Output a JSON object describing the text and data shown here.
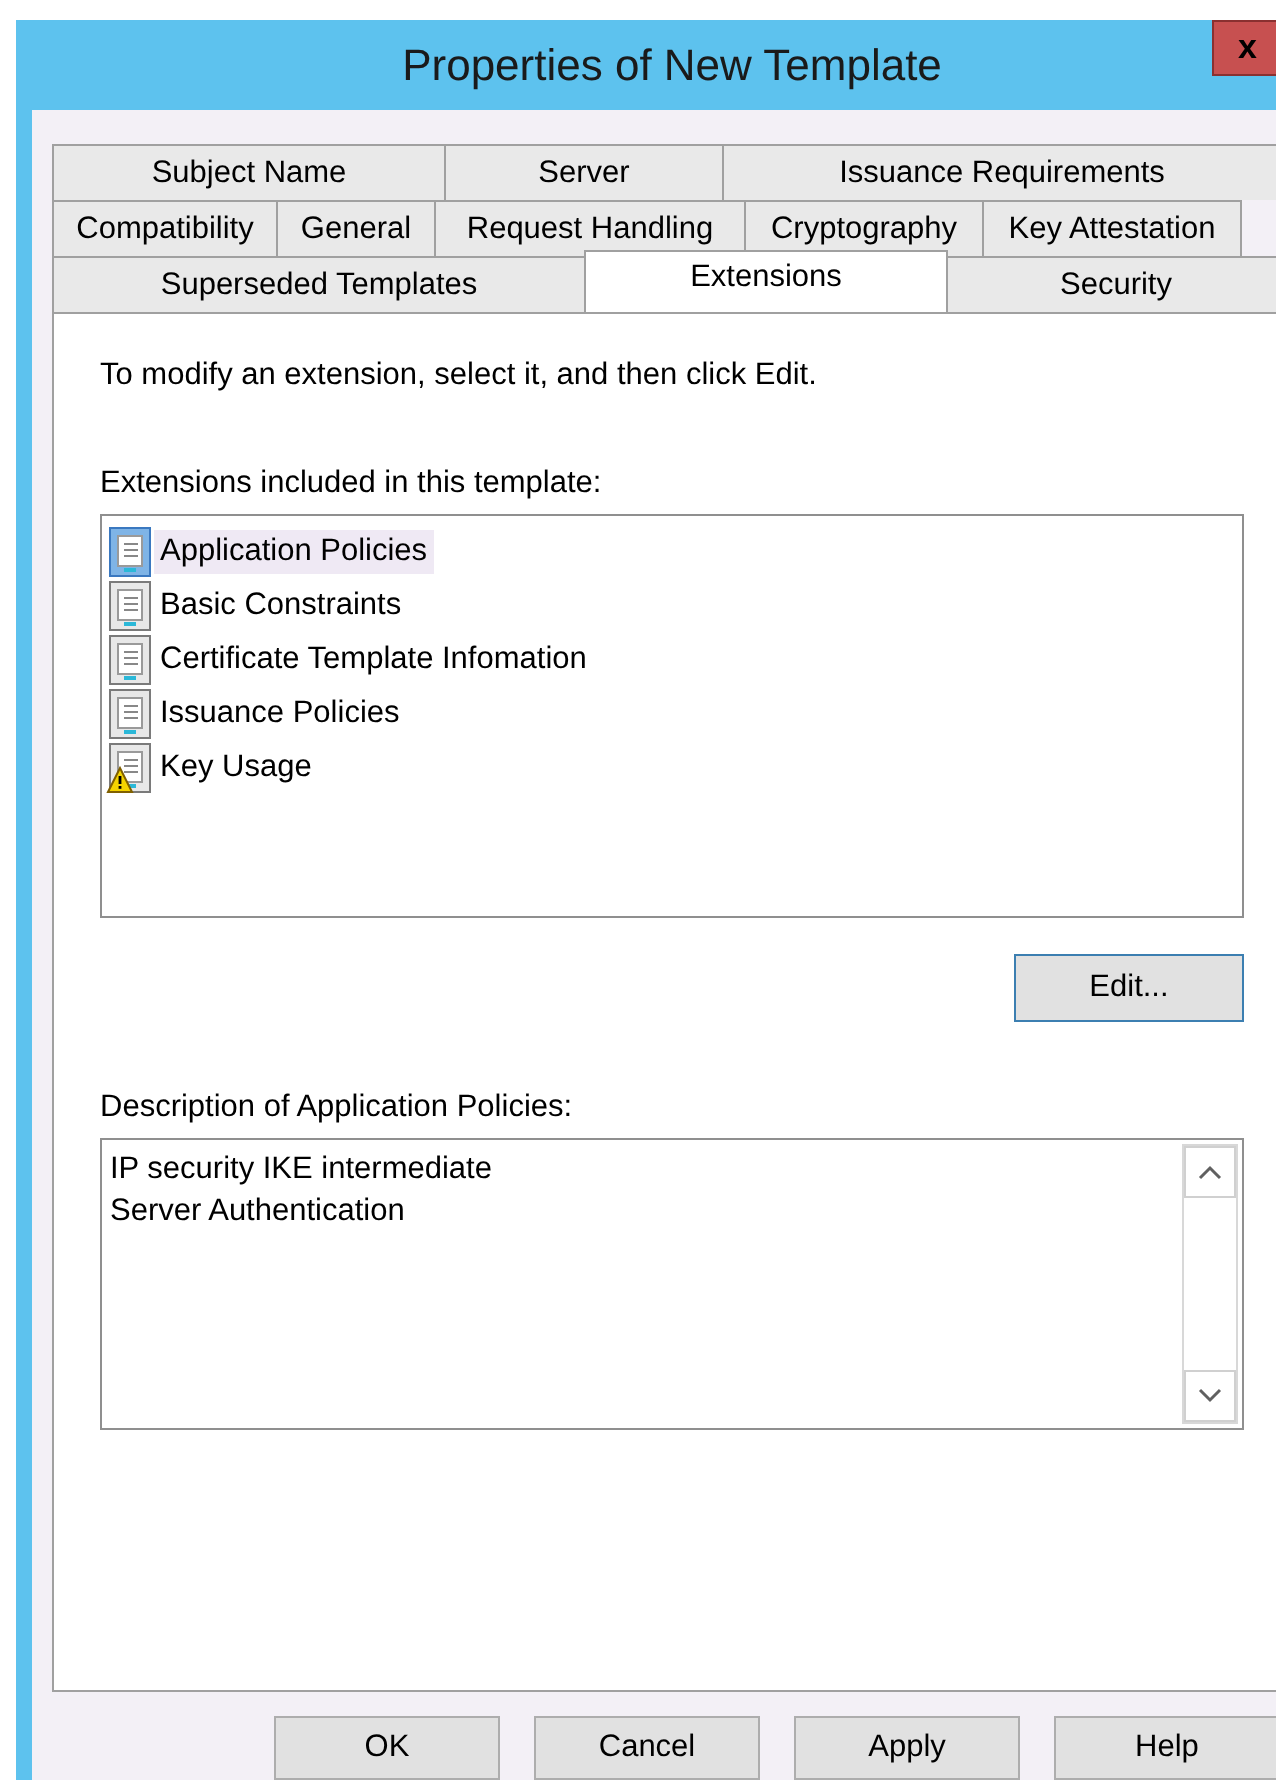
{
  "window": {
    "title": "Properties of New Template",
    "close": "x"
  },
  "tab_rows": [
    [
      {
        "label": "Subject Name",
        "selected": false
      },
      {
        "label": "Server",
        "selected": false
      },
      {
        "label": "Issuance Requirements",
        "selected": false
      }
    ],
    [
      {
        "label": "Compatibility",
        "selected": false
      },
      {
        "label": "General",
        "selected": false
      },
      {
        "label": "Request Handling",
        "selected": false
      },
      {
        "label": "Cryptography",
        "selected": false
      },
      {
        "label": "Key Attestation",
        "selected": false
      }
    ],
    [
      {
        "label": "Superseded Templates",
        "selected": false
      },
      {
        "label": "Extensions",
        "selected": true
      },
      {
        "label": "Security",
        "selected": false
      }
    ]
  ],
  "instruction": "To modify an extension, select it, and then click Edit.",
  "extensions_label": "Extensions included in this template:",
  "extensions": [
    {
      "name": "Application Policies",
      "selected": true,
      "warning": false
    },
    {
      "name": "Basic Constraints",
      "selected": false,
      "warning": false
    },
    {
      "name": "Certificate Template Infomation",
      "selected": false,
      "warning": false
    },
    {
      "name": "Issuance Policies",
      "selected": false,
      "warning": false
    },
    {
      "name": "Key Usage",
      "selected": false,
      "warning": true
    }
  ],
  "edit_button": "Edit...",
  "description_label": "Description of Application Policies:",
  "description_lines": [
    "IP security IKE intermediate",
    "Server Authentication"
  ],
  "buttons": [
    "OK",
    "Cancel",
    "Apply",
    "Help"
  ]
}
